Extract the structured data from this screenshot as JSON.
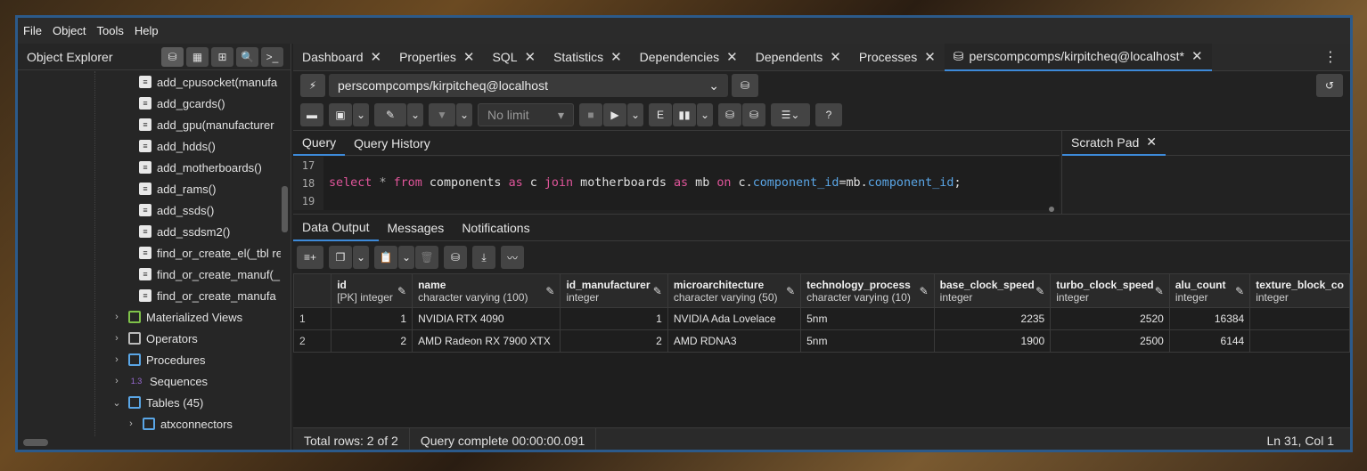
{
  "menu": [
    "File",
    "Object",
    "Tools",
    "Help"
  ],
  "object_explorer": {
    "title": "Object Explorer",
    "functions": [
      "add_cpusocket(manufa",
      "add_gcards()",
      "add_gpu(manufacturer",
      "add_hdds()",
      "add_motherboards()",
      "add_rams()",
      "add_ssds()",
      "add_ssdsm2()",
      "find_or_create_el(_tbl re",
      "find_or_create_manuf(_",
      "find_or_create_manufa"
    ],
    "nodes": [
      {
        "label": "Materialized Views",
        "icon": "materialized-views-icon"
      },
      {
        "label": "Operators",
        "icon": "operators-icon"
      },
      {
        "label": "Procedures",
        "icon": "procedures-icon"
      },
      {
        "label": "Sequences",
        "icon": "sequences-icon",
        "badge": "1.3"
      },
      {
        "label": "Tables (45)",
        "icon": "tables-icon"
      }
    ],
    "child": "atxconnectors"
  },
  "tabs": [
    {
      "label": "Dashboard"
    },
    {
      "label": "Properties"
    },
    {
      "label": "SQL"
    },
    {
      "label": "Statistics"
    },
    {
      "label": "Dependencies"
    },
    {
      "label": "Dependents"
    },
    {
      "label": "Processes"
    },
    {
      "label": "perscompcomps/kirpitcheq@localhost*"
    }
  ],
  "connection": "perscompcomps/kirpitcheq@localhost",
  "limit": "No limit",
  "query_tabs": [
    "Query",
    "Query History"
  ],
  "scratch_pad": "Scratch Pad",
  "editor": {
    "lines": [
      "17",
      "18",
      "19"
    ]
  },
  "result_tabs": [
    "Data Output",
    "Messages",
    "Notifications"
  ],
  "columns": [
    {
      "name": "id",
      "type": "[PK] integer"
    },
    {
      "name": "name",
      "type": "character varying (100)"
    },
    {
      "name": "id_manufacturer",
      "type": "integer"
    },
    {
      "name": "microarchitecture",
      "type": "character varying (50)"
    },
    {
      "name": "technology_process",
      "type": "character varying (10)"
    },
    {
      "name": "base_clock_speed",
      "type": "integer"
    },
    {
      "name": "turbo_clock_speed",
      "type": "integer"
    },
    {
      "name": "alu_count",
      "type": "integer"
    },
    {
      "name": "texture_block_co",
      "type": "integer"
    }
  ],
  "rows": [
    [
      "1",
      "1",
      "NVIDIA RTX 4090",
      "1",
      "NVIDIA Ada Lovelace",
      "5nm",
      "2235",
      "2520",
      "16384",
      ""
    ],
    [
      "2",
      "2",
      "AMD Radeon RX 7900 XTX",
      "2",
      "AMD RDNA3",
      "5nm",
      "1900",
      "2500",
      "6144",
      ""
    ]
  ],
  "status": {
    "total": "Total rows: 2 of 2",
    "query": "Query complete 00:00:00.091",
    "pos": "Ln 31, Col 1"
  },
  "colors": {
    "accent": "#3d8ad9",
    "keyword": "#e0559a",
    "field": "#5aa6e6"
  }
}
